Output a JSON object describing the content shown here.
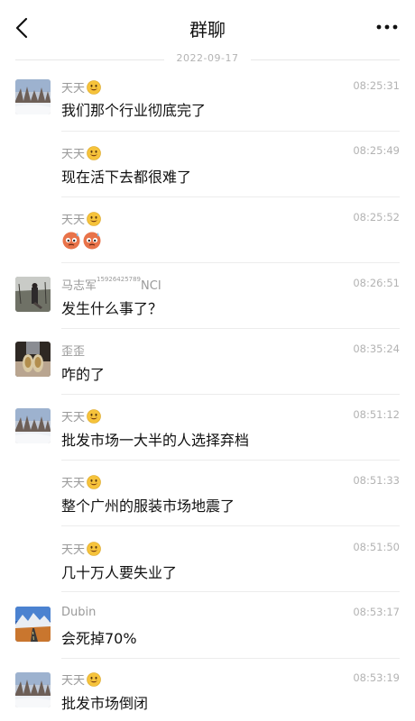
{
  "header": {
    "title": "群聊",
    "back_icon": "chevron-left-icon",
    "more_icon": "more-dots-icon"
  },
  "date_divider": "2022-09-17",
  "messages": [
    {
      "sender": "天天",
      "emoji_after_name": "smile-emoji",
      "time": "08:25:31",
      "text": "我们那个行业彻底完了",
      "avatar": "snow-trees-avatar"
    },
    {
      "sender": "天天",
      "emoji_after_name": "smile-emoji",
      "time": "08:25:49",
      "text": "现在活下去都很难了"
    },
    {
      "sender": "天天",
      "emoji_after_name": "smile-emoji",
      "time": "08:25:52",
      "text": "",
      "content_emojis": [
        "sweat-face-emoji",
        "sweat-face-emoji"
      ]
    },
    {
      "sender": "马志军",
      "sender_superscript": "15926425789",
      "sender_suffix": "NCI",
      "time": "08:26:51",
      "text": "发生什么事了？",
      "avatar": "person-outdoor-avatar"
    },
    {
      "sender": "歪歪",
      "time": "08:35:24",
      "text": "咋的了",
      "avatar": "shoes-avatar"
    },
    {
      "sender": "天天",
      "emoji_after_name": "smile-emoji",
      "time": "08:51:12",
      "text": "批发市场一大半的人选择弃档",
      "avatar": "snow-trees-avatar"
    },
    {
      "sender": "天天",
      "emoji_after_name": "smile-emoji",
      "time": "08:51:33",
      "text": "整个广州的服装市场地震了"
    },
    {
      "sender": "天天",
      "emoji_after_name": "smile-emoji",
      "time": "08:51:50",
      "text": "几十万人要失业了"
    },
    {
      "sender": "Dubin",
      "time": "08:53:17",
      "text": "会死掉70%",
      "avatar": "mountain-road-avatar"
    },
    {
      "sender": "天天",
      "emoji_after_name": "smile-emoji",
      "time": "08:53:19",
      "text": "批发市场倒闭",
      "avatar": "snow-trees-avatar"
    }
  ]
}
